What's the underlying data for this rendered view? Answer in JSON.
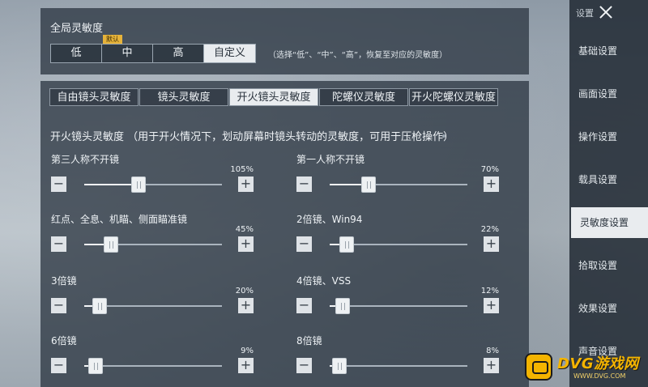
{
  "global": {
    "title": "全局灵敏度",
    "options": [
      "低",
      "中",
      "高",
      "自定义"
    ],
    "default_badge": "默认",
    "active_option": 3,
    "hint": "（选择“低”、“中”、“高”，恢复至对应的灵敏度）"
  },
  "tabs": [
    "自由镜头灵敏度",
    "镜头灵敏度",
    "开火镜头灵敏度",
    "陀螺仪灵敏度",
    "开火陀螺仪灵敏度"
  ],
  "active_tab": 2,
  "section_desc": "开火镜头灵敏度 （用于开火情况下，划动屏幕时镜头转动的灵敏度，可用于压枪操作）",
  "sliders": [
    {
      "label": "第三人称不开镜",
      "value_text": "105%",
      "level": 0.34
    },
    {
      "label": "第一人称不开镜",
      "value_text": "70%",
      "level": 0.23
    },
    {
      "label": "红点、全息、机瞄、侧面瞄准镜",
      "value_text": "45%",
      "level": 0.14
    },
    {
      "label": "2倍镜、Win94",
      "value_text": "22%",
      "level": 0.07
    },
    {
      "label": "3倍镜",
      "value_text": "20%",
      "level": 0.06
    },
    {
      "label": "4倍镜、VSS",
      "value_text": "12%",
      "level": 0.04
    },
    {
      "label": "6倍镜",
      "value_text": "9%",
      "level": 0.03
    },
    {
      "label": "8倍镜",
      "value_text": "8%",
      "level": 0.02
    }
  ],
  "buttons": {
    "minus": "−",
    "plus": "+"
  },
  "menu": {
    "header": "设置",
    "items": [
      "基础设置",
      "画面设置",
      "操作设置",
      "载具设置",
      "灵敏度设置",
      "拾取设置",
      "效果设置",
      "声音设置"
    ],
    "active_index": 4
  },
  "watermark": {
    "brand": "DVG游戏网",
    "url": "WWW.DVG.COM"
  }
}
